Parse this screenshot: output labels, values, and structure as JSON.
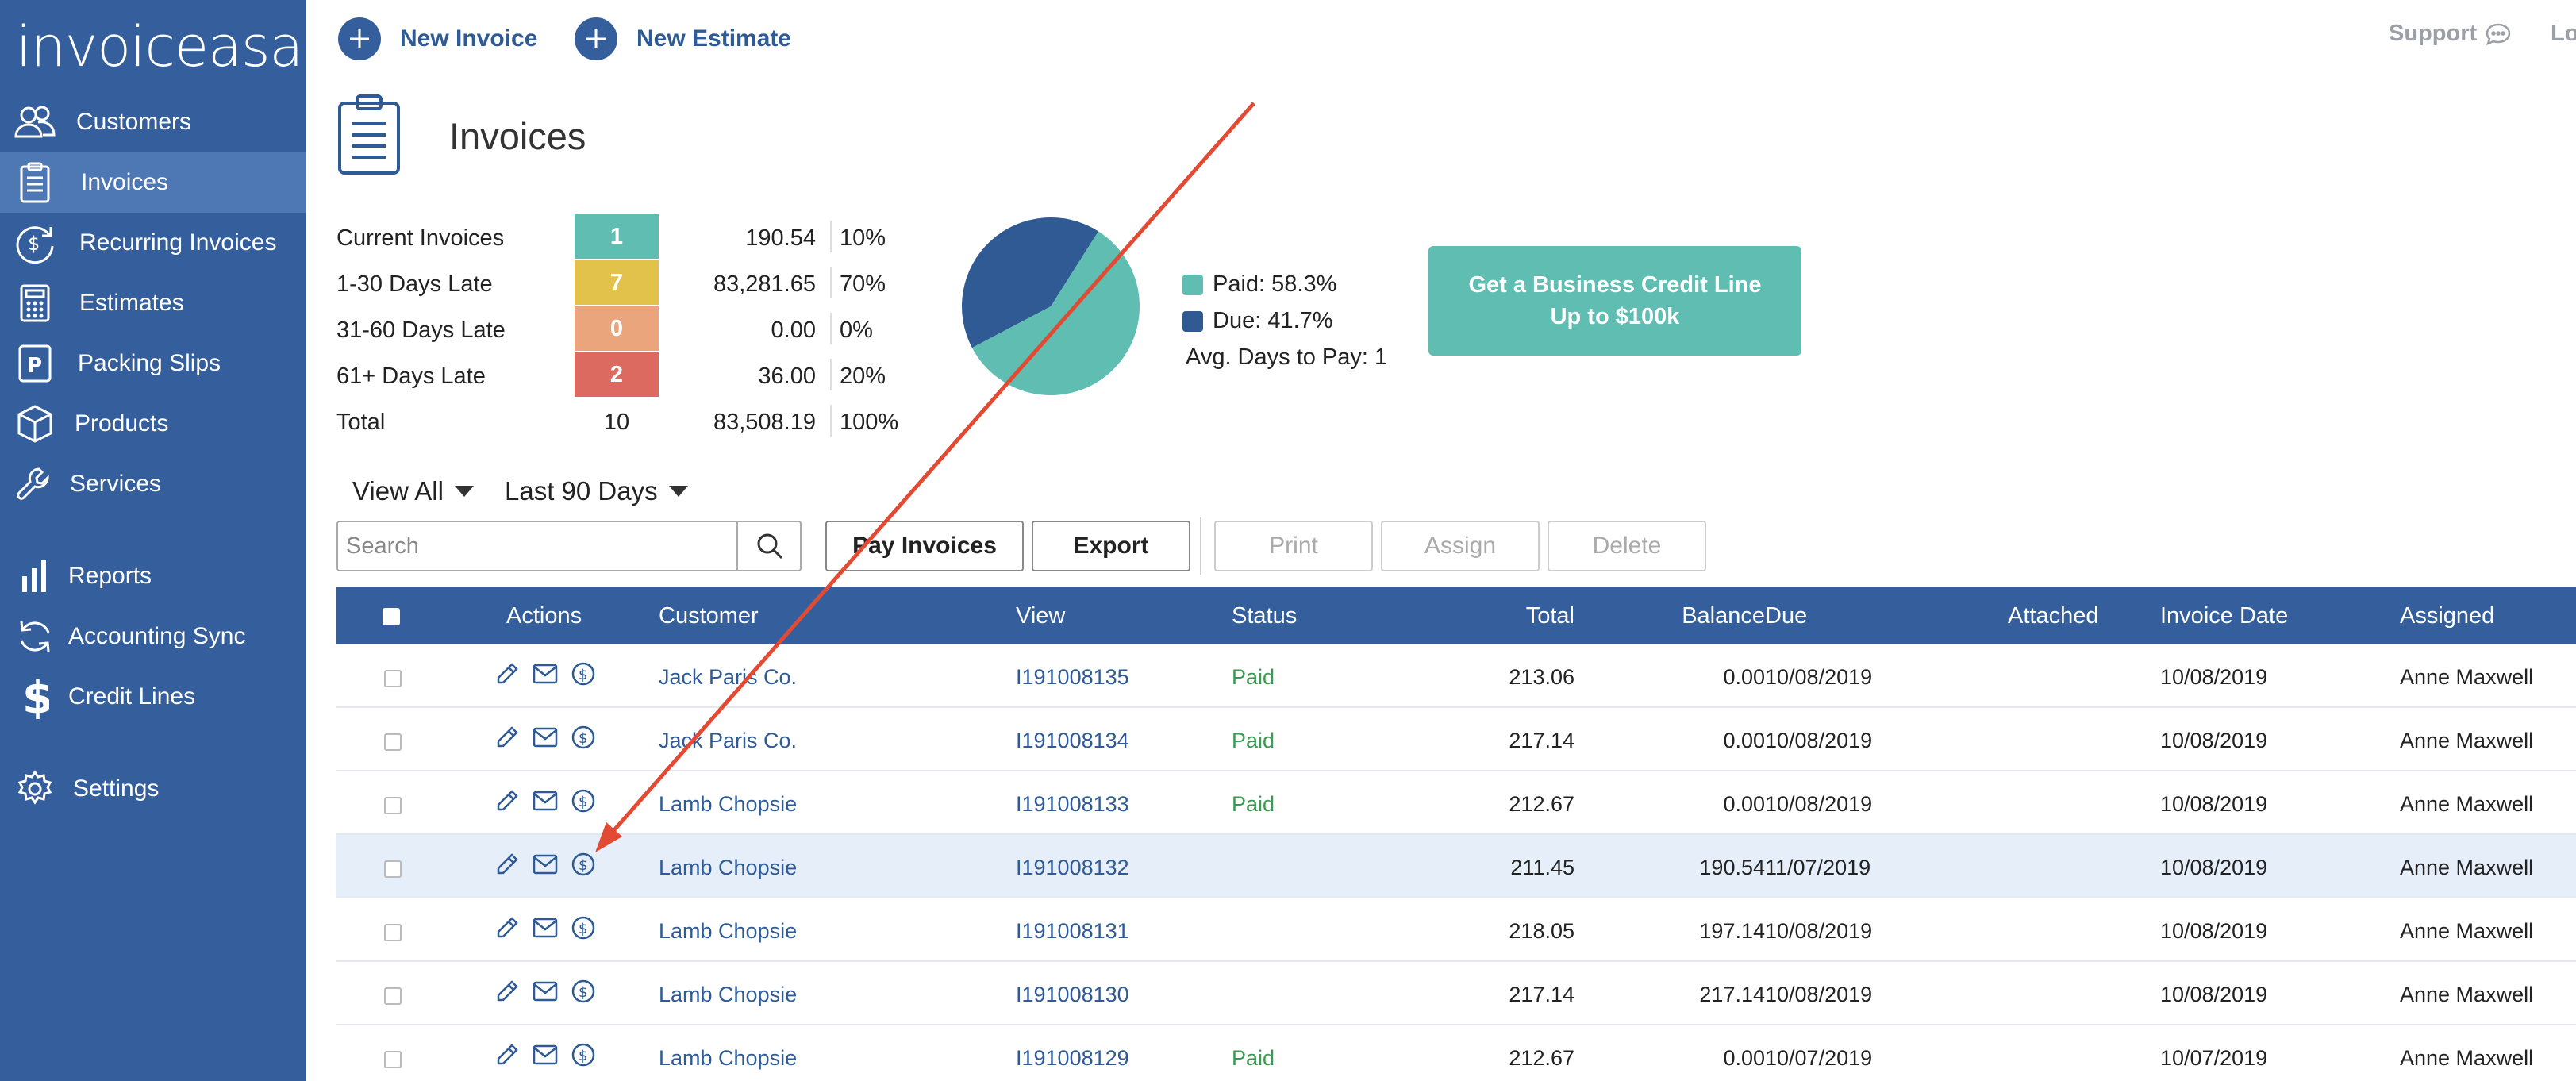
{
  "app": {
    "logo": "invoiceasap"
  },
  "sidebar": {
    "items": [
      {
        "label": "Customers",
        "icon": "users-icon"
      },
      {
        "label": "Invoices",
        "icon": "clipboard-icon",
        "active": true
      },
      {
        "label": "Recurring Invoices",
        "icon": "recurring-dollar-icon"
      },
      {
        "label": "Estimates",
        "icon": "calculator-icon"
      },
      {
        "label": "Packing Slips",
        "icon": "packing-slip-icon"
      },
      {
        "label": "Products",
        "icon": "box-icon"
      },
      {
        "label": "Services",
        "icon": "wrench-icon"
      },
      {
        "label": "Reports",
        "icon": "bar-chart-icon"
      },
      {
        "label": "Accounting Sync",
        "icon": "sync-icon"
      },
      {
        "label": "Credit Lines",
        "icon": "dollar-icon"
      },
      {
        "label": "Settings",
        "icon": "gear-icon"
      }
    ]
  },
  "topbar": {
    "new_invoice": "New Invoice",
    "new_estimate": "New Estimate",
    "support": "Support",
    "logout": "Lo"
  },
  "page": {
    "title": "Invoices"
  },
  "summary": {
    "rows": [
      {
        "label": "Current Invoices",
        "count": "1",
        "amount": "190.54",
        "pct": "10%",
        "color": "#5fbeb1"
      },
      {
        "label": "1-30 Days Late",
        "count": "7",
        "amount": "83,281.65",
        "pct": "70%",
        "color": "#e2c24a"
      },
      {
        "label": "31-60 Days Late",
        "count": "0",
        "amount": "0.00",
        "pct": "0%",
        "color": "#eaa57c"
      },
      {
        "label": "61+ Days Late",
        "count": "2",
        "amount": "36.00",
        "pct": "20%",
        "color": "#dc6a60"
      }
    ],
    "total": {
      "label": "Total",
      "count": "10",
      "amount": "83,508.19",
      "pct": "100%"
    }
  },
  "chart_data": {
    "type": "pie",
    "slices": [
      {
        "name": "Paid",
        "value": 58.3,
        "color": "#5fbeb1"
      },
      {
        "name": "Due",
        "value": 41.7,
        "color": "#2f5a93"
      }
    ],
    "legend": [
      "Paid: 58.3%",
      "Due: 41.7%"
    ],
    "annotation": "Avg. Days to Pay: 1"
  },
  "promo": {
    "line1": "Get a Business Credit Line",
    "line2": "Up to $100k"
  },
  "filters": {
    "view": "View All",
    "range": "Last 90 Days"
  },
  "search": {
    "placeholder": "Search",
    "value": ""
  },
  "toolbar": {
    "pay": "Pay Invoices",
    "export": "Export",
    "print": "Print",
    "assign": "Assign",
    "delete": "Delete"
  },
  "table": {
    "headers": {
      "actions": "Actions",
      "customer": "Customer",
      "view": "View",
      "status": "Status",
      "total": "Total",
      "balance": "Balance",
      "due": "Due",
      "attached": "Attached",
      "invoice_date": "Invoice Date",
      "assigned": "Assigned"
    },
    "rows": [
      {
        "customer": "Jack Paris Co.",
        "view": "I191008135",
        "status": "Paid",
        "total": "213.06",
        "balance": "0.00",
        "due": "10/08/2019",
        "attached": "",
        "invoice_date": "10/08/2019",
        "assigned": "Anne Maxwell"
      },
      {
        "customer": "Jack Paris Co.",
        "view": "I191008134",
        "status": "Paid",
        "total": "217.14",
        "balance": "0.00",
        "due": "10/08/2019",
        "attached": "",
        "invoice_date": "10/08/2019",
        "assigned": "Anne Maxwell"
      },
      {
        "customer": "Lamb Chopsie",
        "view": "I191008133",
        "status": "Paid",
        "total": "212.67",
        "balance": "0.00",
        "due": "10/08/2019",
        "attached": "",
        "invoice_date": "10/08/2019",
        "assigned": "Anne Maxwell"
      },
      {
        "customer": "Lamb Chopsie",
        "view": "I191008132",
        "status": "",
        "total": "211.45",
        "balance": "190.54",
        "due": "11/07/2019",
        "attached": "",
        "invoice_date": "10/08/2019",
        "assigned": "Anne Maxwell",
        "highlight": true
      },
      {
        "customer": "Lamb Chopsie",
        "view": "I191008131",
        "status": "",
        "total": "218.05",
        "balance": "197.14",
        "due": "10/08/2019",
        "attached": "",
        "invoice_date": "10/08/2019",
        "assigned": "Anne Maxwell"
      },
      {
        "customer": "Lamb Chopsie",
        "view": "I191008130",
        "status": "",
        "total": "217.14",
        "balance": "217.14",
        "due": "10/08/2019",
        "attached": "",
        "invoice_date": "10/08/2019",
        "assigned": "Anne Maxwell"
      },
      {
        "customer": "Lamb Chopsie",
        "view": "I191008129",
        "status": "Paid",
        "total": "212.67",
        "balance": "0.00",
        "due": "10/07/2019",
        "attached": "",
        "invoice_date": "10/07/2019",
        "assigned": "Anne Maxwell"
      }
    ]
  }
}
